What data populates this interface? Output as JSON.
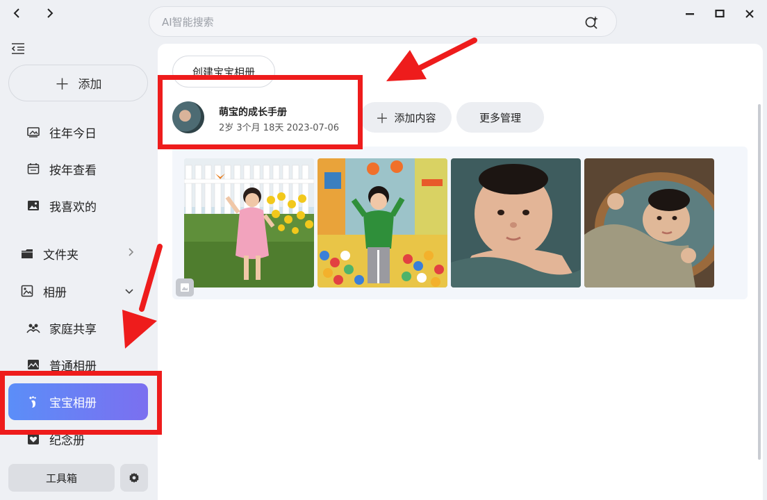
{
  "nav": {
    "back_icon": "chevron-left-icon",
    "forward_icon": "chevron-right-icon"
  },
  "search": {
    "placeholder": "AI智能搜索",
    "icon": "ai-search-icon"
  },
  "window": {
    "minimize_icon": "minimize-icon",
    "maximize_icon": "maximize-icon",
    "close_icon": "close-icon"
  },
  "sidebar": {
    "add_label": "添加",
    "items": [
      {
        "label": "往年今日",
        "icon": "photo-frame-icon"
      },
      {
        "label": "按年查看",
        "icon": "calendar-icon"
      },
      {
        "label": "我喜欢的",
        "icon": "image-icon"
      },
      {
        "label": "文件夹",
        "icon": "folder-icon"
      },
      {
        "label": "相册",
        "icon": "album-icon"
      },
      {
        "label": "家庭共享",
        "icon": "family-icon"
      },
      {
        "label": "普通相册",
        "icon": "landscape-icon"
      },
      {
        "label": "宝宝相册",
        "icon": "footprint-icon"
      },
      {
        "label": "纪念册",
        "icon": "heart-book-icon"
      }
    ],
    "toolbox_label": "工具箱"
  },
  "main": {
    "create_label": "创建宝宝相册",
    "album": {
      "title": "萌宝的成长手册",
      "meta": "2岁 3个月 18天  2023-07-06"
    },
    "add_content_label": "添加内容",
    "more_label": "更多管理"
  },
  "colors": {
    "accent_start": "#5b8ef8",
    "accent_end": "#7b6ff0",
    "annotation_red": "#ee1c1c"
  }
}
